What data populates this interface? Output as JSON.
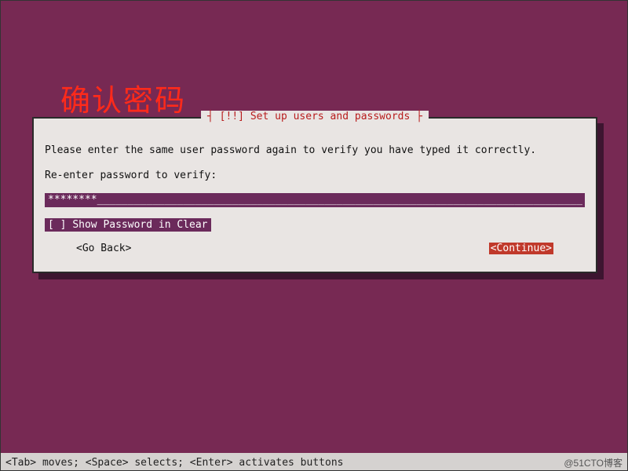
{
  "heading_cn": "确认密码",
  "dialog": {
    "title_full": "[!!] Set up users and passwords",
    "title_bracket_open": "┤ ",
    "title_bracket_close": " ├",
    "instruction": "Please enter the same user password again to verify you have typed it correctly.",
    "prompt": "Re-enter password to verify:",
    "password_masked": "********",
    "checkbox_state": "[ ]",
    "checkbox_label": "Show Password in Clear",
    "go_back_label": "<Go Back>",
    "continue_label": "<Continue>"
  },
  "footer": {
    "hint": "<Tab> moves; <Space> selects; <Enter> activates buttons",
    "watermark": "@51CTO博客"
  }
}
